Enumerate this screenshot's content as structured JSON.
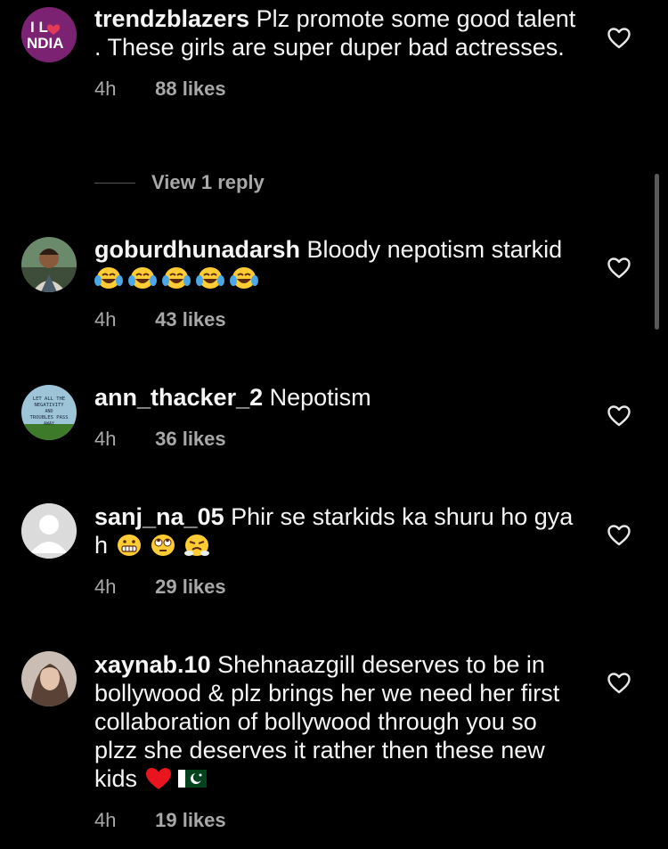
{
  "comments": [
    {
      "username": "trendzblazers",
      "text": "Plz promote some good talent . These girls are super duper bad actresses.",
      "time": "4h",
      "likes": "88 likes",
      "avatar_text_top": "I L",
      "avatar_text_bottom": "NDIA",
      "view_replies": "View 1 reply"
    },
    {
      "username": "goburdhunadarsh",
      "text": "Bloody nepotism starkid",
      "time": "4h",
      "likes": "43 likes",
      "emojis": [
        "face-with-tears-of-joy",
        "face-with-tears-of-joy",
        "face-with-tears-of-joy",
        "face-with-tears-of-joy",
        "face-with-tears-of-joy"
      ]
    },
    {
      "username": "ann_thacker_2",
      "text": "Nepotism",
      "time": "4h",
      "likes": "36 likes",
      "avatar_text": "LET ALL THE NEGATIVITY AND TROUBLES PASS AWAY"
    },
    {
      "username": "sanj_na_05",
      "text": "Phir se starkids ka shuru ho gya h",
      "time": "4h",
      "likes": "29 likes",
      "emojis": [
        "grimacing-face",
        "face-with-rolling-eyes",
        "face-with-steam-from-nose"
      ]
    },
    {
      "username": "xaynab.10",
      "text": "Shehnaazgill deserves to be in bollywood & plz brings her we need her first collaboration of bollywood through you so plzz she deserves it rather then these new kids",
      "time": "4h",
      "likes": "19 likes",
      "emojis": [
        "red-heart",
        "flag-pakistan"
      ]
    }
  ],
  "colors": {
    "background": "#000000",
    "text": "#f5f5f5",
    "secondary": "#a8a8a8",
    "avatar1": "#6a1b7a"
  }
}
